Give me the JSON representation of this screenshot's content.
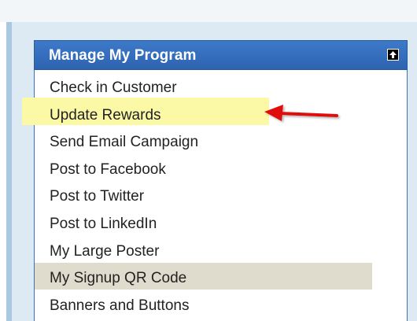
{
  "panel": {
    "title": "Manage My Program",
    "collapse_icon": "arrow-up-icon",
    "header_color": "#2f67b3"
  },
  "menu": {
    "items": [
      {
        "label": "Check in Customer"
      },
      {
        "label": "Update Rewards",
        "highlight": "yellow"
      },
      {
        "label": "Send Email Campaign"
      },
      {
        "label": "Post to Facebook"
      },
      {
        "label": "Post to Twitter"
      },
      {
        "label": "Post to LinkedIn"
      },
      {
        "label": "My Large Poster"
      },
      {
        "label": "My Signup QR Code",
        "highlight": "gray"
      },
      {
        "label": "Banners and Buttons"
      }
    ]
  },
  "annotation": {
    "icon": "red-arrow-icon",
    "color": "#e01010",
    "highlight_color": "#fbf8a6"
  }
}
